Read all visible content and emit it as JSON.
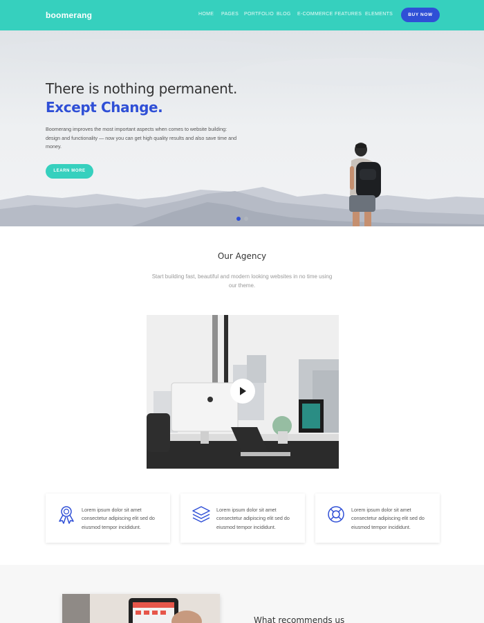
{
  "header": {
    "logo": "boomerang",
    "nav": [
      "HOME",
      "PAGES",
      "PORTFOLIO",
      "BLOG",
      "E-COMMERCE",
      "FEATURES",
      "ELEMENTS"
    ],
    "buy_label": "BUY NOW"
  },
  "hero": {
    "title": "There is nothing permanent.",
    "subtitle": "Except Change.",
    "text": "Boomerang improves the most important aspects when comes to website building: design and functionality — now you can get high quality results and also save time and money.",
    "button": "LEARN MORE",
    "slides": 2,
    "active_slide": 1
  },
  "agency": {
    "title": "Our Agency",
    "text": "Start building fast, beautiful and modern looking websites in no time using our theme.",
    "video_icon": "play-icon"
  },
  "features": [
    {
      "icon": "award-ribbon-icon",
      "text": "Lorem ipsum dolor sit amet consectetur adipiscing elit sed do eiusmod tempor incididunt."
    },
    {
      "icon": "layers-icon",
      "text": "Lorem ipsum dolor sit amet consectetur adipiscing elit sed do eiusmod tempor incididunt."
    },
    {
      "icon": "lifebuoy-icon",
      "text": "Lorem ipsum dolor sit amet consectetur adipiscing elit sed do eiusmod tempor incididunt."
    }
  ],
  "section2": {
    "title": "What recommends us"
  },
  "colors": {
    "header": "#36d0be",
    "accent": "#2f4fd6",
    "button": "#36d0be"
  }
}
